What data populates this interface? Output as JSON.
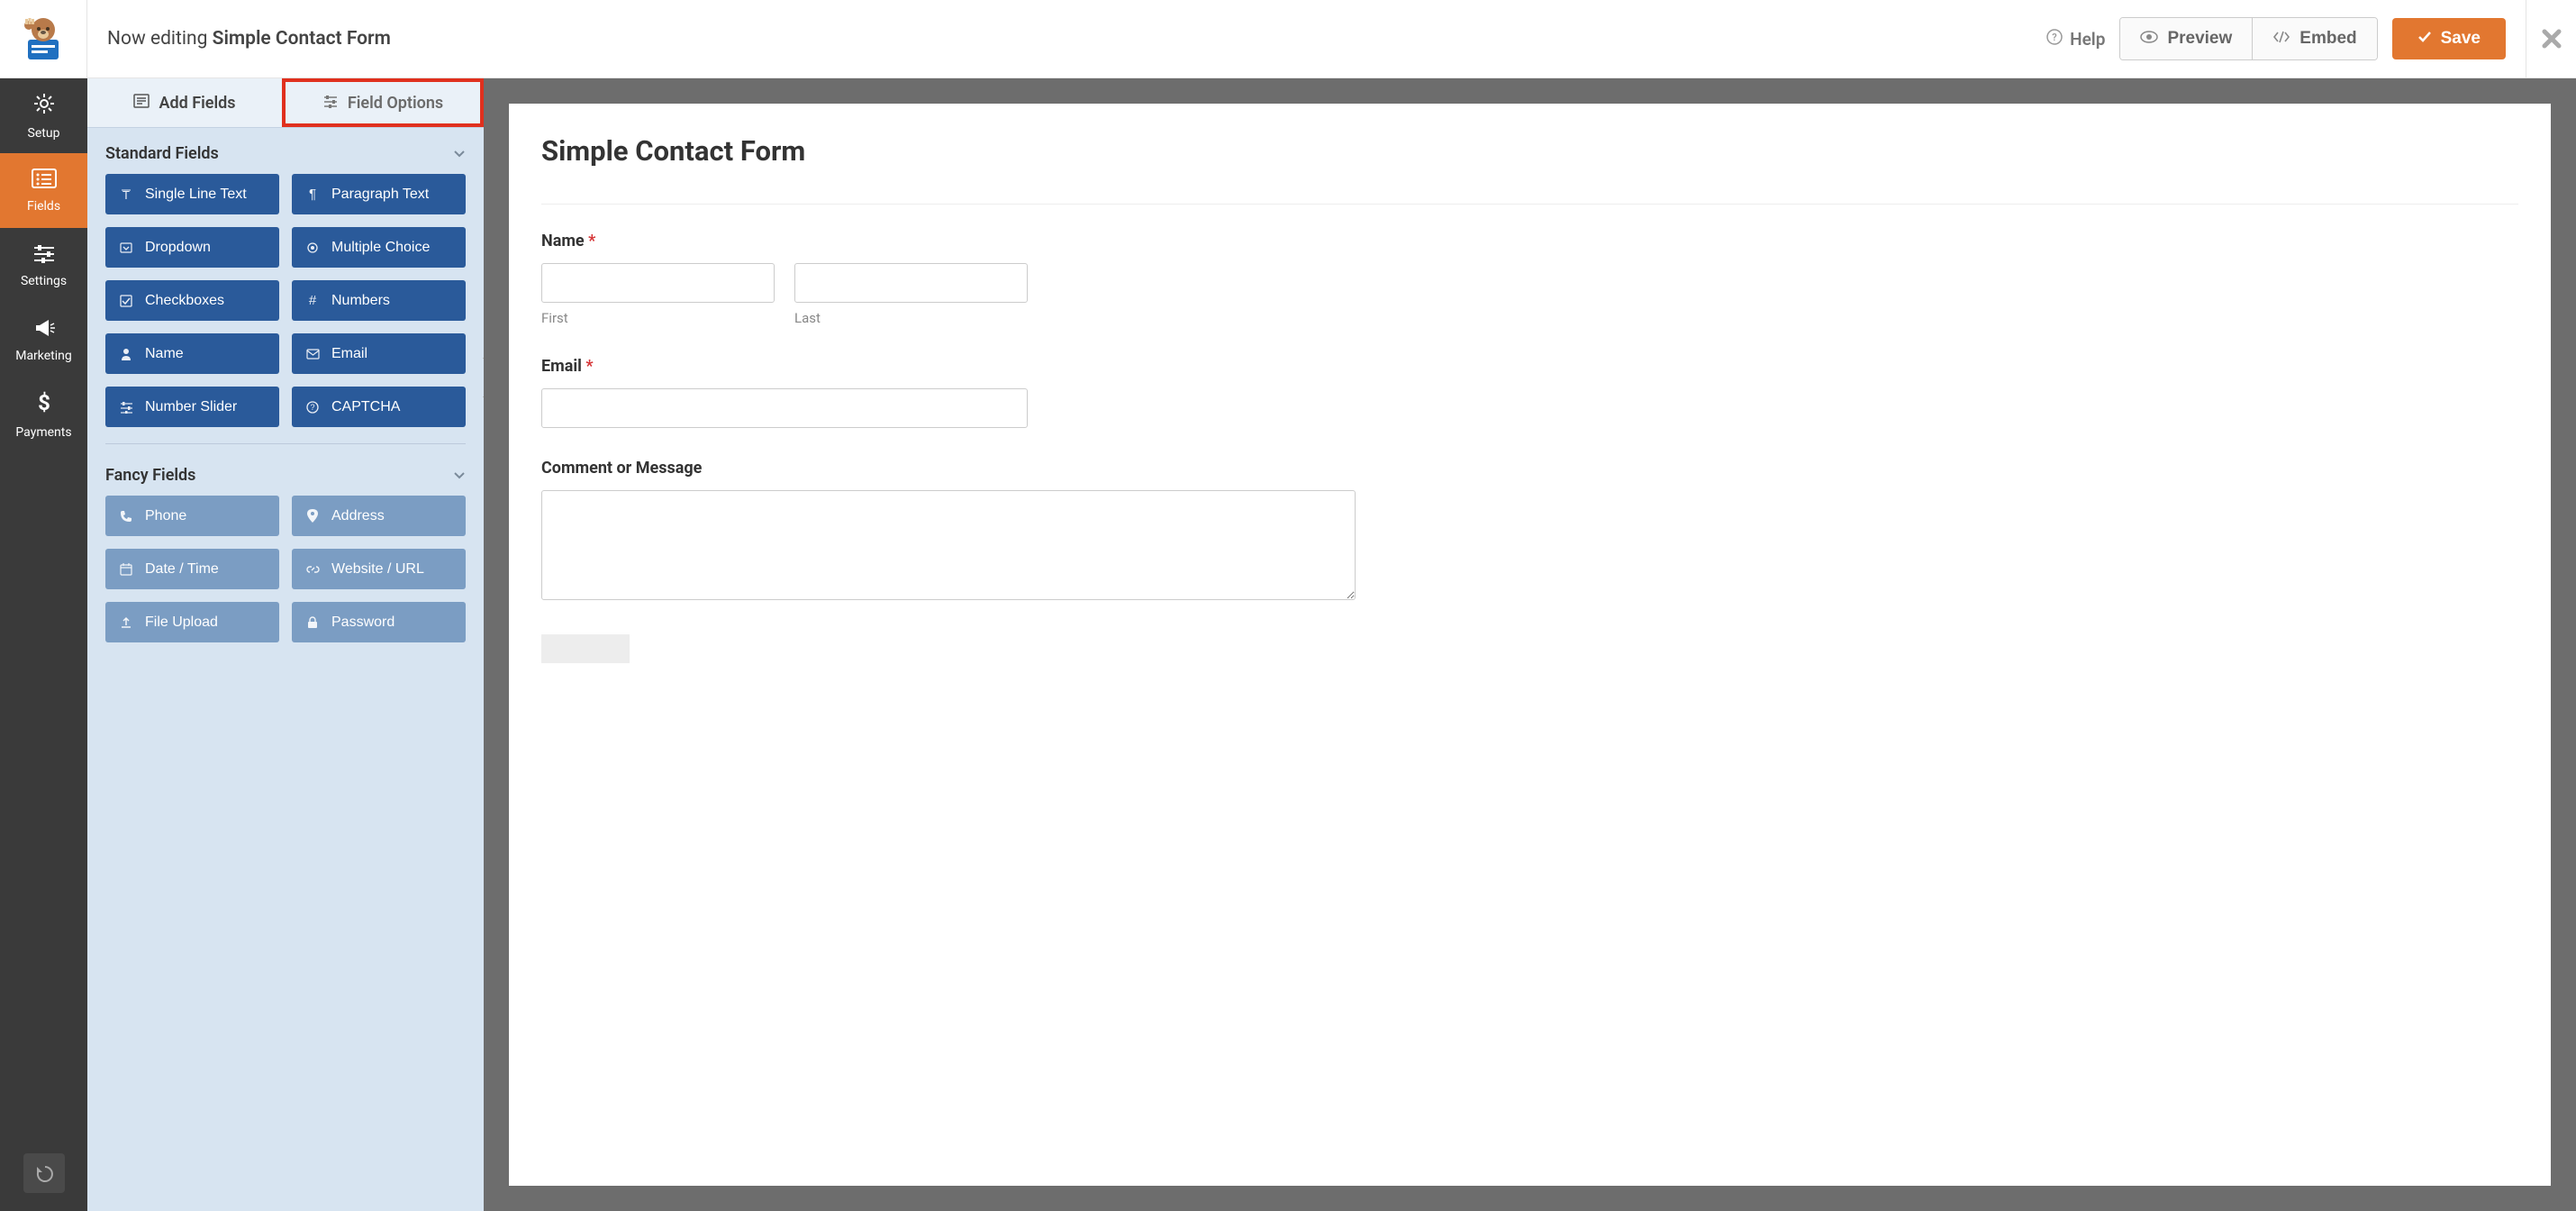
{
  "topbar": {
    "editing_prefix": "Now editing",
    "form_name": "Simple Contact Form",
    "help_label": "Help",
    "preview_label": "Preview",
    "embed_label": "Embed",
    "save_label": "Save"
  },
  "iconnav": {
    "setup": "Setup",
    "fields": "Fields",
    "settings": "Settings",
    "marketing": "Marketing",
    "payments": "Payments"
  },
  "panel": {
    "tab_add_fields": "Add Fields",
    "tab_field_options": "Field Options",
    "sections": {
      "standard": {
        "title": "Standard Fields",
        "items": [
          {
            "label": "Single Line Text",
            "icon": "T"
          },
          {
            "label": "Paragraph Text",
            "icon": "¶"
          },
          {
            "label": "Dropdown",
            "icon": "▾"
          },
          {
            "label": "Multiple Choice",
            "icon": "◉"
          },
          {
            "label": "Checkboxes",
            "icon": "☑"
          },
          {
            "label": "Numbers",
            "icon": "#"
          },
          {
            "label": "Name",
            "icon": "👤"
          },
          {
            "label": "Email",
            "icon": "✉"
          },
          {
            "label": "Number Slider",
            "icon": "≡"
          },
          {
            "label": "CAPTCHA",
            "icon": "?"
          }
        ]
      },
      "fancy": {
        "title": "Fancy Fields",
        "items": [
          {
            "label": "Phone",
            "icon": "📞"
          },
          {
            "label": "Address",
            "icon": "📍"
          },
          {
            "label": "Date / Time",
            "icon": "📅"
          },
          {
            "label": "Website / URL",
            "icon": "🔗"
          },
          {
            "label": "File Upload",
            "icon": "⬆"
          },
          {
            "label": "Password",
            "icon": "🔒"
          }
        ]
      }
    }
  },
  "form": {
    "title": "Simple Contact Form",
    "fields": {
      "name": {
        "label": "Name",
        "required": "*",
        "first_sublabel": "First",
        "last_sublabel": "Last"
      },
      "email": {
        "label": "Email",
        "required": "*"
      },
      "comment": {
        "label": "Comment or Message"
      }
    }
  }
}
